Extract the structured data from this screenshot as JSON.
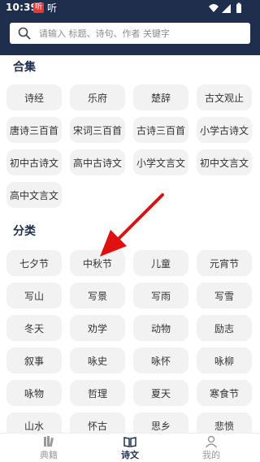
{
  "status_bar": {
    "time": "10:39",
    "app_badge": "听",
    "app2": "听"
  },
  "search": {
    "placeholder": "请输入 标题、诗句、作者 关键字"
  },
  "collections": {
    "title": "合集",
    "items": [
      "诗经",
      "乐府",
      "楚辞",
      "古文观止",
      "唐诗三百首",
      "宋词三百首",
      "古诗三百首",
      "小学古诗文",
      "初中古诗文",
      "高中古诗文",
      "小学文言文",
      "初中文言文",
      "高中文言文"
    ]
  },
  "categories": {
    "title": "分类",
    "items": [
      "七夕节",
      "中秋节",
      "儿童",
      "元宵节",
      "写山",
      "写景",
      "写雨",
      "写雪",
      "冬天",
      "劝学",
      "动物",
      "励志",
      "叙事",
      "咏史",
      "咏怀",
      "咏柳",
      "咏物",
      "哲理",
      "夏天",
      "寒食节",
      "山水",
      "怀古",
      "思乡",
      "悲愤"
    ]
  },
  "bottom_nav": [
    {
      "label": "典籍",
      "icon": "books-icon",
      "active": false
    },
    {
      "label": "诗文",
      "icon": "open-book-icon",
      "active": true
    },
    {
      "label": "我的",
      "icon": "user-icon",
      "active": false
    }
  ],
  "colors": {
    "header": "#1e2e4c",
    "chip_bg": "#f2f2f2",
    "arrow": "#e01010"
  }
}
